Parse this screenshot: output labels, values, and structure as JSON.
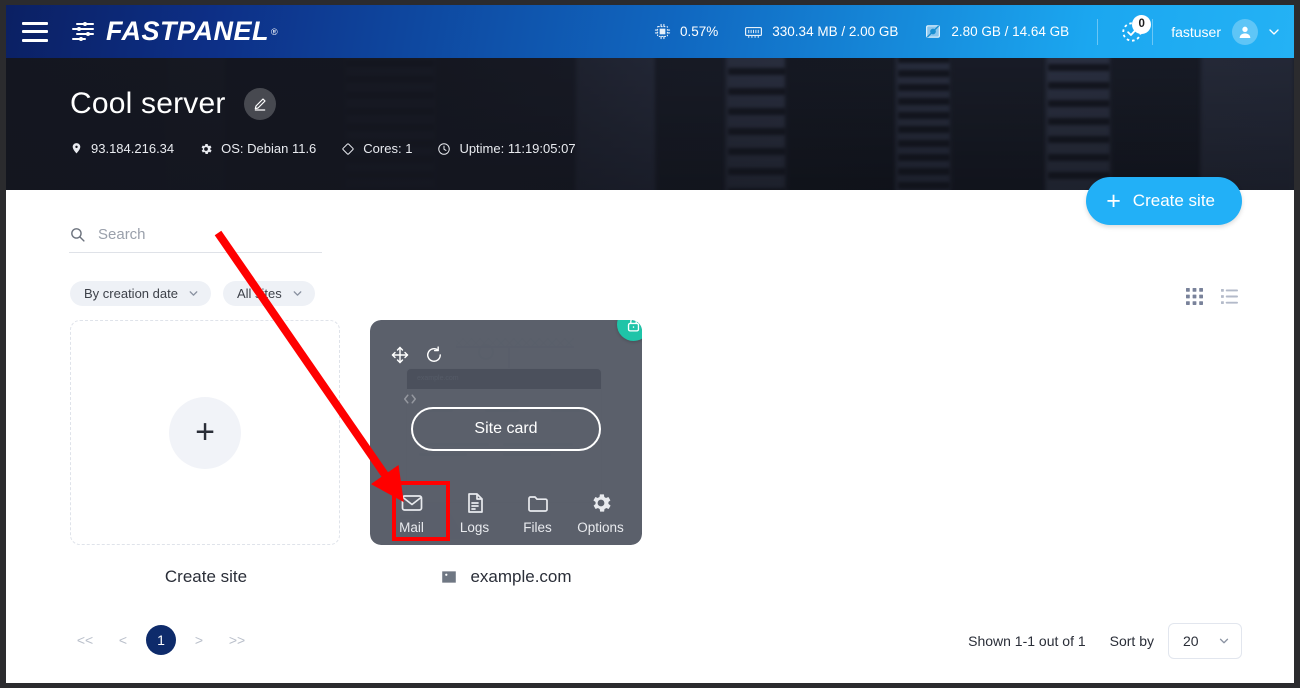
{
  "topbar": {
    "menu_icon": "hamburger-icon",
    "brand": "FASTPANEL",
    "brand_mark": "®",
    "stats": [
      {
        "icon": "cpu-icon",
        "value": "0.57%"
      },
      {
        "icon": "ram-icon",
        "value": "330.34 MB / 2.00 GB"
      },
      {
        "icon": "disk-icon",
        "value": "2.80 GB / 14.64 GB"
      }
    ],
    "notifications": {
      "icon": "task-check-icon",
      "count": "0"
    },
    "user": {
      "name": "fastuser",
      "avatar_icon": "user-avatar-icon",
      "caret_icon": "chevron-down-icon"
    }
  },
  "banner": {
    "title": "Cool server",
    "edit_icon": "pencil-icon",
    "meta": [
      {
        "icon": "location-pin-icon",
        "text": "93.184.216.34"
      },
      {
        "icon": "gear-icon",
        "text": "OS: Debian 11.6"
      },
      {
        "icon": "diamond-icon",
        "text": "Cores: 1"
      },
      {
        "icon": "clock-icon",
        "text": "Uptime: 11:19:05:07"
      }
    ]
  },
  "actions": {
    "create_site_label": "Create site",
    "create_site_plus": "+"
  },
  "filters": {
    "search_placeholder": "Search",
    "search_value": "",
    "search_icon": "search-icon",
    "chips": [
      {
        "label": "By creation date",
        "icon": "chevron-down-icon"
      },
      {
        "label": "All sites",
        "icon": "chevron-down-icon"
      }
    ],
    "view_modes": [
      {
        "icon": "grid-view-icon",
        "active": true
      },
      {
        "icon": "list-view-icon",
        "active": false
      }
    ]
  },
  "cards": {
    "create": {
      "plus": "+",
      "caption": "Create site"
    },
    "site": {
      "caption": "example.com",
      "caption_icon": "image-placeholder-icon",
      "overlay_label": "Site card",
      "ssl_icon": "lock-icon",
      "mock_url": "example.com",
      "corner_icons": [
        {
          "icon": "move-icon"
        },
        {
          "icon": "reload-icon"
        },
        {
          "icon": "code-icon"
        }
      ],
      "actions": [
        {
          "icon": "mail-icon",
          "label": "Mail",
          "highlighted": true
        },
        {
          "icon": "logs-icon",
          "label": "Logs",
          "highlighted": false
        },
        {
          "icon": "folder-icon",
          "label": "Files",
          "highlighted": false
        },
        {
          "icon": "gear-icon",
          "label": "Options",
          "highlighted": false
        }
      ]
    }
  },
  "footer": {
    "pagination": [
      {
        "label": "<<",
        "type": "first",
        "active": false
      },
      {
        "label": "<",
        "type": "prev",
        "active": false
      },
      {
        "label": "1",
        "type": "page",
        "active": true
      },
      {
        "label": ">",
        "type": "next",
        "active": false
      },
      {
        "label": ">>",
        "type": "last",
        "active": false
      }
    ],
    "shown": "Shown 1-1 out of 1",
    "sort_by_label": "Sort by",
    "page_size": "20",
    "page_size_icon": "chevron-down-icon"
  },
  "annotation": {
    "arrow_color": "#FF0000",
    "highlight_color": "#FF0000",
    "target": "Mail"
  },
  "colors": {
    "accent_blue": "#22b0f7",
    "brand_dark": "#0b2063",
    "page_badge": "#0e2b6b",
    "ssl_green": "#1fc4a8"
  }
}
